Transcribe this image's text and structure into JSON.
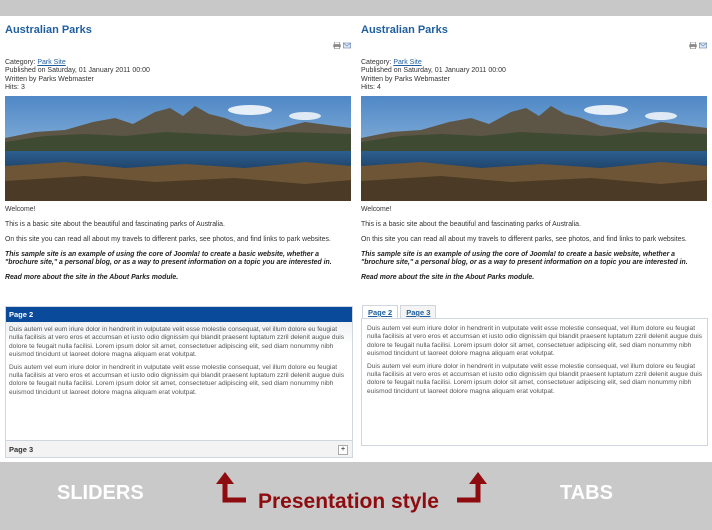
{
  "panels": [
    {
      "title": "Australian Parks",
      "meta": {
        "category_label": "Category:",
        "category_link": "Park Site",
        "published": "Published on Saturday, 01 January 2011 00:00",
        "written": "Written by Parks Webmaster",
        "hits": "Hits: 3"
      },
      "welcome": "Welcome!",
      "p1": "This is a basic site about the beautiful and fascinating parks of Australia.",
      "p2": "On this site you can read all about my travels to different parks, see photos, and find links to park websites.",
      "p3": "This sample site is an example of using the core of Joomla! to create a basic website, whether a \"brochure site,\"  a personal blog, or as a way to present information on a topic you are interested in.",
      "p4": "Read more about the site in the About Parks module."
    },
    {
      "title": "Australian Parks",
      "meta": {
        "category_label": "Category:",
        "category_link": "Park Site",
        "published": "Published on Saturday, 01 January 2011 00:00",
        "written": "Written by Parks Webmaster",
        "hits": "Hits: 4"
      },
      "welcome": "Welcome!",
      "p1": "This is a basic site about the beautiful and fascinating parks of Australia.",
      "p2": "On this site you can read all about my travels to different parks, see photos, and find links to park websites.",
      "p3": "This sample site is an example of using the core of Joomla! to create a basic website, whether a \"brochure site,\"  a personal blog, or as a way to present information on a topic you are interested in.",
      "p4": "Read more about the site in the About Parks module."
    }
  ],
  "sliders": {
    "open_title": "Page 2",
    "closed_title": "Page 3",
    "lorem1": "Duis autem vel eum iriure dolor in hendrerit in vulputate velit esse molestie consequat, vel illum dolore eu feugiat nulla facilisis at vero eros et accumsan et iusto odio dignissim qui blandit praesent luptatum zzril delenit augue duis dolore te feugait nulla facilisi. Lorem ipsum dolor sit amet, consectetuer adipiscing elit, sed diam nonummy nibh euismod tincidunt ut laoreet dolore magna aliquam erat volutpat.",
    "lorem2": "Duis autem vel eum iriure dolor in hendrerit in vulputate velit esse molestie consequat, vel illum dolore eu feugiat nulla facilisis at vero eros et accumsan et iusto odio dignissim qui blandit praesent luptatum zzril delenit augue duis dolore te feugait nulla facilisi. Lorem ipsum dolor sit amet, consectetuer adipiscing elit, sed diam nonummy nibh euismod tincidunt ut laoreet dolore magna aliquam erat volutpat.",
    "plus": "+"
  },
  "tabs": {
    "items": [
      "Page 2",
      "Page 3"
    ],
    "active_index": 0,
    "lorem1": "Duis autem vel eum iriure dolor in hendrerit in vulputate velit esse molestie consequat, vel illum dolore eu feugiat nulla facilisis at vero eros et accumsan et iusto odio dignissim qui blandit praesent luptatum zzril delenit augue duis dolore te feugait nulla facilisi. Lorem ipsum dolor sit amet, consectetuer adipiscing elit, sed diam nonummy nibh euismod tincidunt ut laoreet dolore magna aliquam erat volutpat.",
    "lorem2": "Duis autem vel eum iriure dolor in hendrerit in vulputate velit esse molestie consequat, vel illum dolore eu feugiat nulla facilisis at vero eros et accumsan et iusto odio dignissim qui blandit praesent luptatum zzril delenit augue duis dolore te feugait nulla facilisi. Lorem ipsum dolor sit amet, consectetuer adipiscing elit, sed diam nonummy nibh euismod tincidunt ut laoreet dolore magna aliquam erat volutpat."
  },
  "captions": {
    "sliders": "SLIDERS",
    "presentation": "Presentation style",
    "tabs": "TABS"
  },
  "colors": {
    "link": "#1f5f9f",
    "slider_header": "#0a4a9a",
    "caption_accent": "#8e0c10",
    "caption_bg": "#c9c9c9"
  },
  "icons": [
    "print-icon",
    "email-icon",
    "expand-plus-icon",
    "arrow-up-left-icon",
    "arrow-up-right-icon"
  ]
}
